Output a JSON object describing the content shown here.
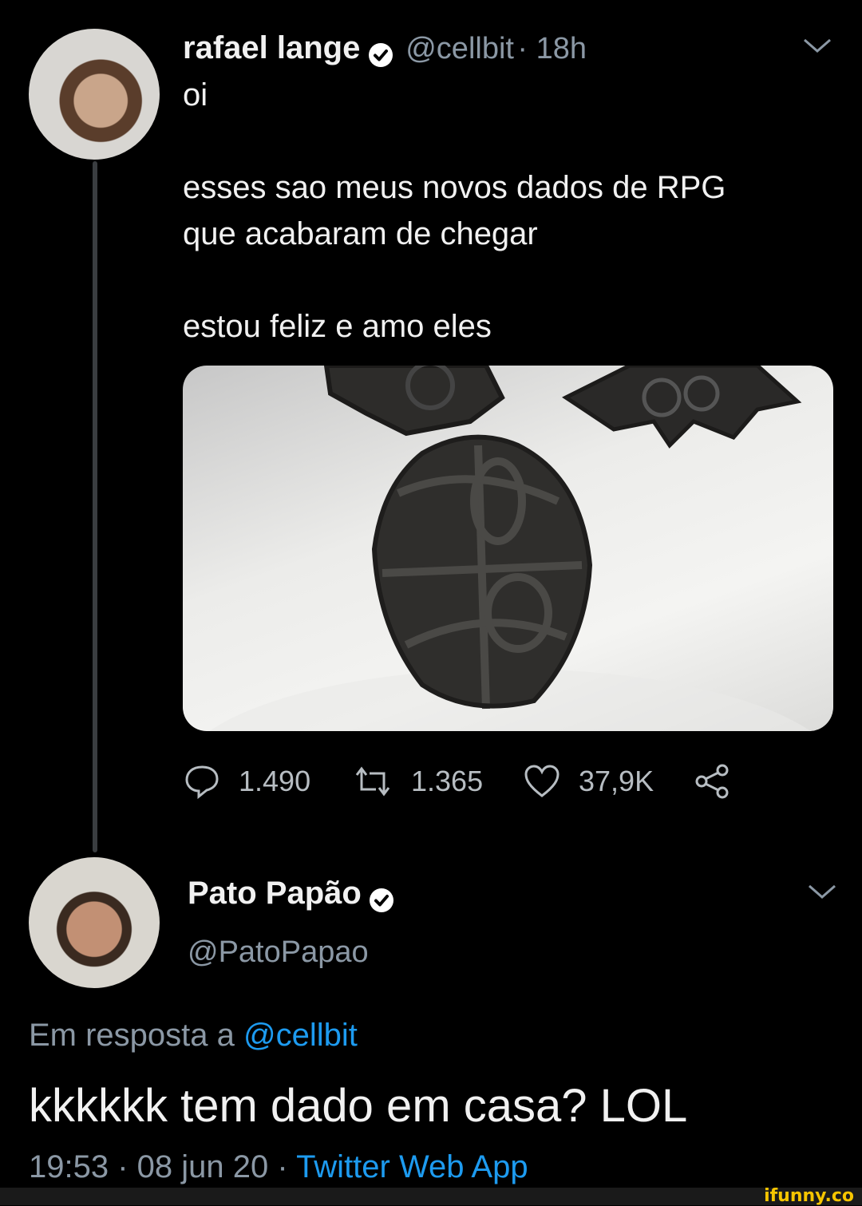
{
  "tweet": {
    "author_name": "rafael lange",
    "handle": "@cellbit",
    "time": "· 18h",
    "text_lines": [
      "oi",
      "",
      "esses sao meus novos dados de RPG",
      "que acabaram de chegar",
      "",
      "estou feliz e amo eles"
    ],
    "stats": {
      "replies": "1.490",
      "retweets": "1.365",
      "likes": "37,9K"
    }
  },
  "reply": {
    "author_name": "Pato Papão",
    "handle": "@PatoPapao",
    "reply_to_prefix": "Em resposta a ",
    "reply_to_mention": "@cellbit",
    "text": "kkkkkk tem dado em casa? LOL",
    "timestamp": "19:53 · 08 jun 20 · ",
    "source": "Twitter Web App"
  },
  "watermark": "ifunny.co",
  "colors": {
    "background": "#000000",
    "link": "#1d9bf0",
    "muted": "#8b98a5",
    "verified": "#ffffff"
  },
  "icons": [
    "verified-icon",
    "chevron-down-icon",
    "reply-icon",
    "retweet-icon",
    "like-icon",
    "share-icon"
  ]
}
